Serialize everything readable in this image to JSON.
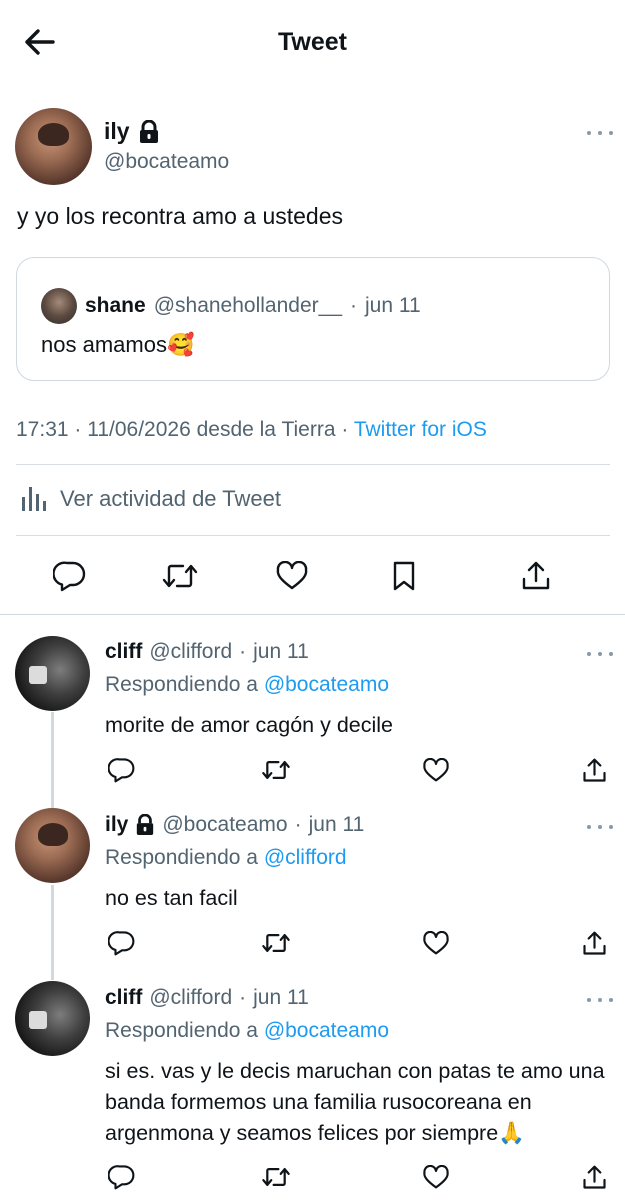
{
  "header": {
    "title": "Tweet",
    "back_icon": "arrow-left-icon"
  },
  "main_tweet": {
    "name": "ily",
    "handle": "@bocateamo",
    "text": "y yo los recontra amo a ustedes",
    "quote": {
      "name": "shane",
      "handle": "@shanehollander__",
      "sep": "·",
      "date": "jun 11",
      "text": "nos amamos🥰"
    },
    "meta": {
      "time_date": "17:31 · 11/06/2026 desde la Tierra ·",
      "source": "Twitter for iOS"
    },
    "activity_label": "Ver actividad de Tweet"
  },
  "replies": [
    {
      "name": "cliff",
      "handle": "@clifford",
      "sep": "·",
      "date": "jun 11",
      "replying_prefix": "Respondiendo a",
      "replying_to": "@bocateamo",
      "text": "morite de amor cagón y decile"
    },
    {
      "name": "ily",
      "handle": "@bocateamo",
      "sep": "·",
      "date": "jun 11",
      "replying_prefix": "Respondiendo a",
      "replying_to": "@clifford",
      "text": "no es tan facil"
    },
    {
      "name": "cliff",
      "handle": "@clifford",
      "sep": "·",
      "date": "jun 11",
      "replying_prefix": "Respondiendo a",
      "replying_to": "@bocateamo",
      "text": "si es. vas y le decis maruchan con patas te amo una banda formemos una familia rusocoreana en argenmona y seamos felices por siempre🙏"
    }
  ],
  "colors": {
    "link": "#1d9bf0",
    "muted": "#536471",
    "divider": "#cfd9de"
  }
}
